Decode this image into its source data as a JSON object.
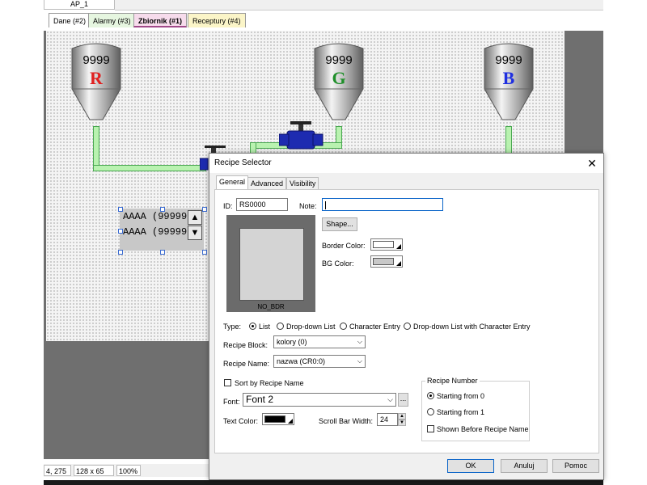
{
  "document_tab": "AP_1",
  "screen_tabs": [
    {
      "label": "Dane (#2)",
      "color": "#ffffff"
    },
    {
      "label": "Alarmy (#3)",
      "color": "#e6f6e0"
    },
    {
      "label": "Zbiornik (#1)",
      "color": "#f7dcec"
    },
    {
      "label": "Receptury (#4)",
      "color": "#fbf5c8"
    }
  ],
  "canvas": {
    "tanks": [
      {
        "value": "9999",
        "letter": "R",
        "letter_color": "#e02020"
      },
      {
        "value": "9999",
        "letter": "G",
        "letter_color": "#1f8f2a"
      },
      {
        "value": "9999",
        "letter": "B",
        "letter_color": "#1f2fe0"
      }
    ],
    "recipe_list_items": [
      "AAAA (99999",
      "AAAA (99999"
    ],
    "scroll_up_glyph": "▲",
    "scroll_down_glyph": "▼"
  },
  "status_bar": {
    "coords": "4, 275",
    "size": "128 x 65",
    "zoom": "100%"
  },
  "dialog": {
    "title": "Recipe Selector",
    "close_glyph": "✕",
    "tabs": [
      "General",
      "Advanced",
      "Visibility"
    ],
    "active_tab": "General",
    "id_label": "ID:",
    "id_value": "RS0000",
    "note_label": "Note:",
    "note_value": "",
    "preview_caption": "NO_BDR",
    "shape_button": "Shape...",
    "border_color_label": "Border Color:",
    "bg_color_label": "BG Color:",
    "type_label": "Type:",
    "type_options": [
      "List",
      "Drop-down List",
      "Character Entry",
      "Drop-down List with Character Entry"
    ],
    "type_selected": "List",
    "recipe_block_label": "Recipe Block:",
    "recipe_block_value": "kolory (0)",
    "recipe_name_label": "Recipe Name:",
    "recipe_name_value": "nazwa (CR0:0)",
    "sort_label": "Sort by Recipe Name",
    "font_label": "Font:",
    "font_value": "Font 2",
    "font_browse": "...",
    "text_color_label": "Text Color:",
    "scroll_width_label": "Scroll Bar Width:",
    "scroll_width_value": "24",
    "recipe_number_group": "Recipe Number",
    "start_from_0": "Starting from 0",
    "start_from_1": "Starting from 1",
    "shown_before": "Shown Before Recipe Name",
    "ok": "OK",
    "cancel": "Anuluj",
    "help": "Pomoc",
    "colors": {
      "border": "#ffffff",
      "bg": "#c8c8c8",
      "text": "#000000",
      "preview_outer": "#6b6b6b",
      "preview_inner": "#d4d4d4",
      "accent": "#0a64c8"
    }
  }
}
